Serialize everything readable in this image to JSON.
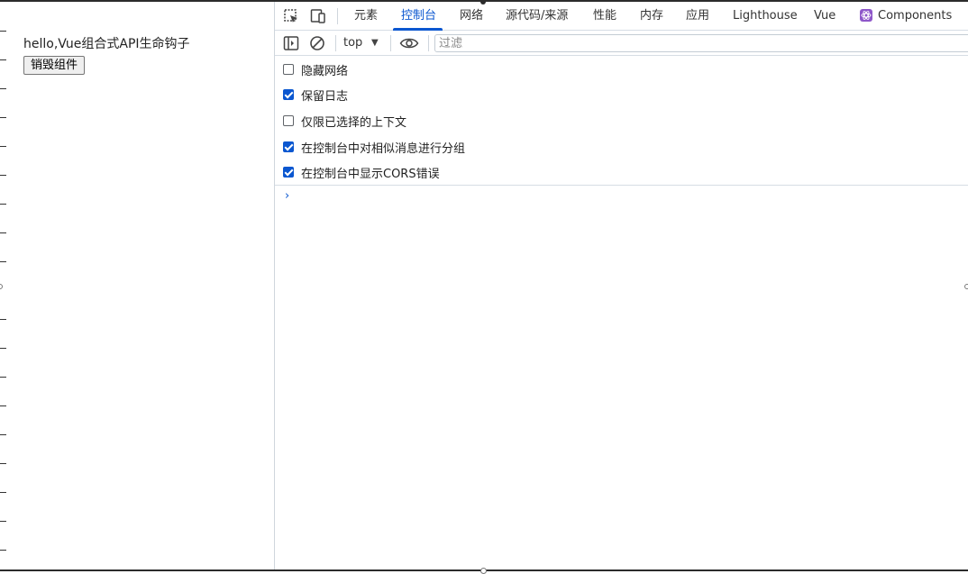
{
  "page": {
    "title": "hello,Vue组合式API生命钩子",
    "destroy_button": "销毁组件"
  },
  "devtools": {
    "tabs": [
      {
        "label": "元素",
        "active": false
      },
      {
        "label": "控制台",
        "active": true
      },
      {
        "label": "网络",
        "active": false
      },
      {
        "label": "源代码/来源",
        "active": false
      },
      {
        "label": "性能",
        "active": false
      },
      {
        "label": "内存",
        "active": false
      },
      {
        "label": "应用",
        "active": false
      },
      {
        "label": "Lighthouse",
        "active": false
      },
      {
        "label": "Vue",
        "active": false
      },
      {
        "label": "Components",
        "active": false
      }
    ],
    "toolbar": {
      "context": "top",
      "filter_placeholder": "过滤"
    },
    "settings": [
      {
        "label": "隐藏网络",
        "checked": false
      },
      {
        "label": "保留日志",
        "checked": true
      },
      {
        "label": "仅限已选择的上下文",
        "checked": false
      },
      {
        "label": "在控制台中对相似消息进行分组",
        "checked": true
      },
      {
        "label": "在控制台中显示CORS错误",
        "checked": true
      }
    ],
    "prompt_glyph": "›",
    "accent_color": "#0b57d0"
  }
}
